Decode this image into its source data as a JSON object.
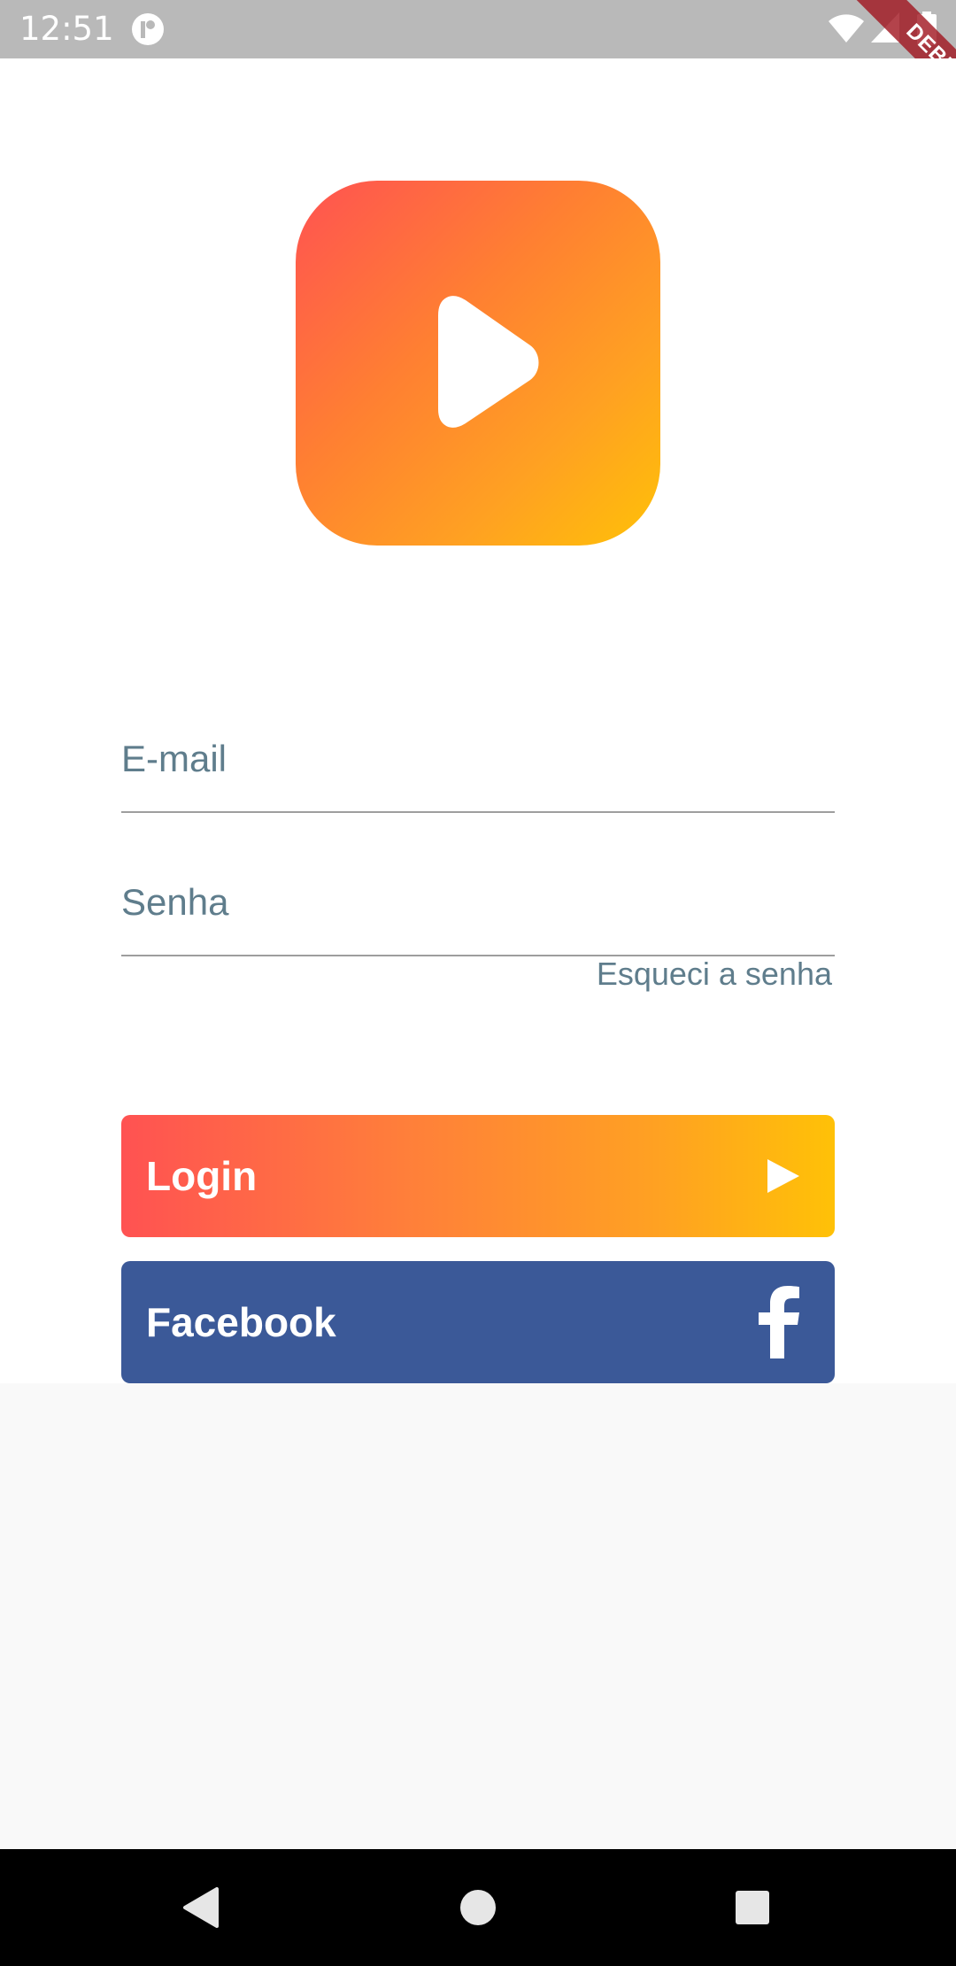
{
  "status_bar": {
    "time": "12:51",
    "icons": [
      "app-notification-icon",
      "wifi-icon",
      "signal-icon",
      "battery-icon"
    ]
  },
  "debug_banner": "DEBUG",
  "logo": {
    "icon": "play-icon",
    "gradient": [
      "#ff5252",
      "#ffc107"
    ]
  },
  "form": {
    "email_placeholder": "E-mail",
    "email_value": "",
    "password_placeholder": "Senha",
    "password_value": "",
    "forgot_password": "Esqueci a senha"
  },
  "buttons": {
    "login_label": "Login",
    "login_icon": "play-icon",
    "facebook_label": "Facebook",
    "facebook_icon": "facebook-icon",
    "facebook_color": "#3b5998"
  },
  "nav_bar": {
    "icons": [
      "back-icon",
      "home-icon",
      "recents-icon"
    ]
  }
}
